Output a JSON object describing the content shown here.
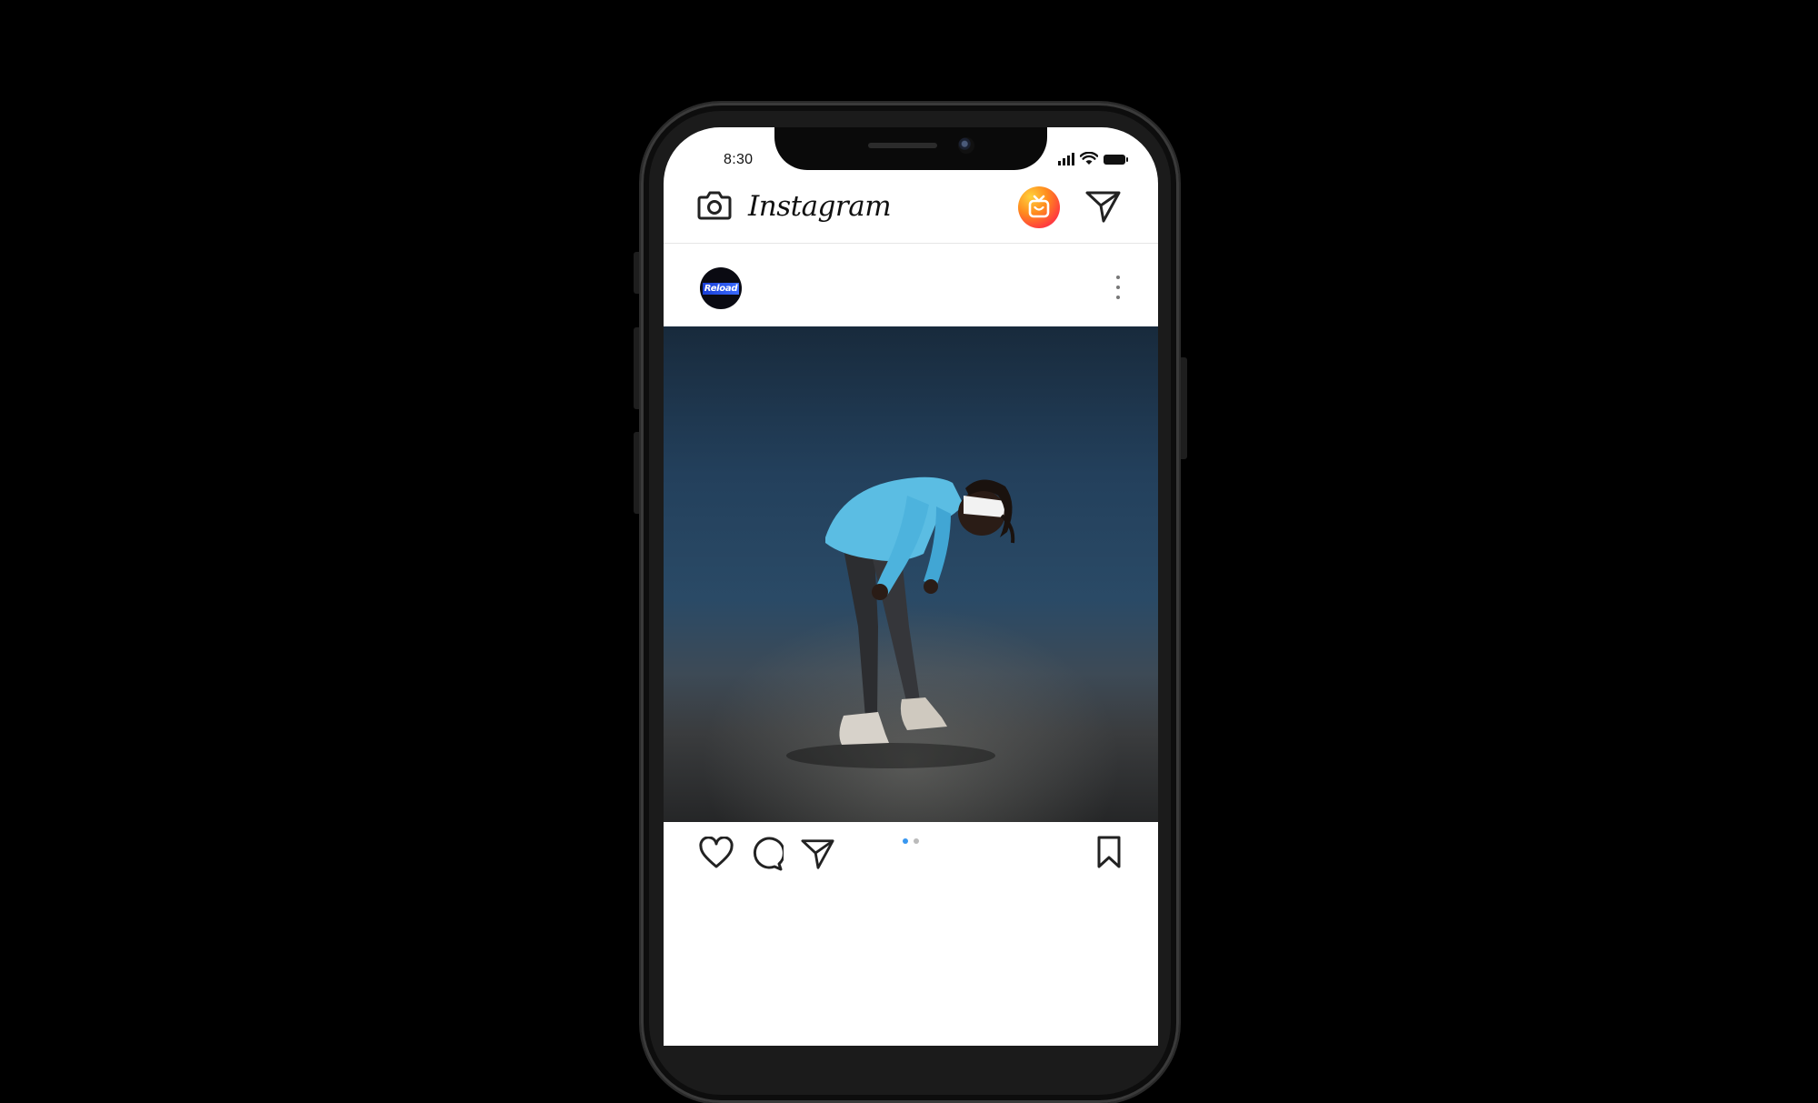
{
  "status_bar": {
    "time": "8:30"
  },
  "app": {
    "name": "Instagram"
  },
  "post": {
    "avatar_text": "Reload",
    "carousel": {
      "count": 2,
      "active": 1
    }
  },
  "icons": {
    "header_left": "camera-icon",
    "header_right": [
      "igtv-icon",
      "direct-message-icon"
    ],
    "post_menu": "more-vertical-icon",
    "actions": [
      "heart-icon",
      "comment-icon",
      "share-icon"
    ],
    "save": "bookmark-icon"
  },
  "colors": {
    "background": "#000000",
    "screen": "#ffffff",
    "carousel_active": "#3897f0"
  }
}
